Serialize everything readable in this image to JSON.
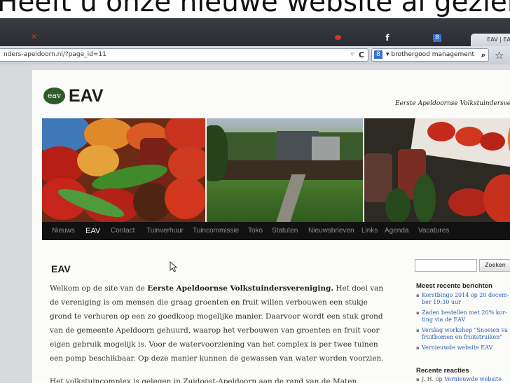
{
  "caption": "Heeft u onze nieuwe website al gezien?",
  "browser": {
    "tab_close": "✕",
    "tab_facebook_icon": "f",
    "tab_s_icon": "8",
    "active_tab_label": "EAV | EAV",
    "url": "nders-apeldoorn.nl/?page_id=11",
    "url_dropdown": "▿",
    "reload": "C",
    "search_engine": "8",
    "search_text": "▾ brothergood management",
    "search_go": "⌕",
    "bookmark_star": "☆"
  },
  "site": {
    "logo_badge": "eav",
    "logo_text": "EAV",
    "tagline": "Eerste Apeldoornse Volkstuindersvereniging",
    "menu": [
      "Nieuws",
      "EAV",
      "Contact",
      "Tuinverhuur",
      "Tuincommissie",
      "Toko",
      "Statuten",
      "Nieuwsbrieven",
      "Links",
      "Agenda",
      "Vacatures"
    ],
    "active_menu": "EAV",
    "page_title": "EAV",
    "para1_a": "Welkom op de site van de ",
    "para1_b": "Eerste Apeldoornse Volkstuindersvereniging.",
    "para1_c": " Het doel van de vereniging is om mensen die graag groenten en fruit willen verbouwen een stukje grond te verhuren op een zo goedkoop mogelijke manier. Daarvoor wordt een stuk grond van de gemeente Apeldoorn gehuurd, waarop het verbouwen van groenten en fruit voor eigen gebruik mogelijk is. Voor de watervoorziening van het complex is per twee tuinen een pomp beschikbaar. Op deze manier kunnen de gewassen van water worden voorzien.",
    "para2": "Het volkstuincomplex is gelegen in Zuidoost-Apeldoorn aan de rand van de Maten,"
  },
  "sidebar": {
    "search_button": "Zoeken",
    "recent_posts_heading": "Meest recente berichten",
    "recent_posts": [
      [
        "Kerstbingo 2014 op 20 decem-",
        "ber 19:30 uur"
      ],
      [
        "Zaden bestellen met 20% kor-",
        "ting via de EAV"
      ],
      [
        "Verslag workshop \"Snoeien va",
        "fruitbomen en fruitstruiken\""
      ],
      [
        "Vernieuwde website EAV"
      ]
    ],
    "recent_comments_heading": "Recente reacties",
    "recent_comment_author": "J. H. op",
    "recent_comment_link": "Vernieuwde website"
  }
}
